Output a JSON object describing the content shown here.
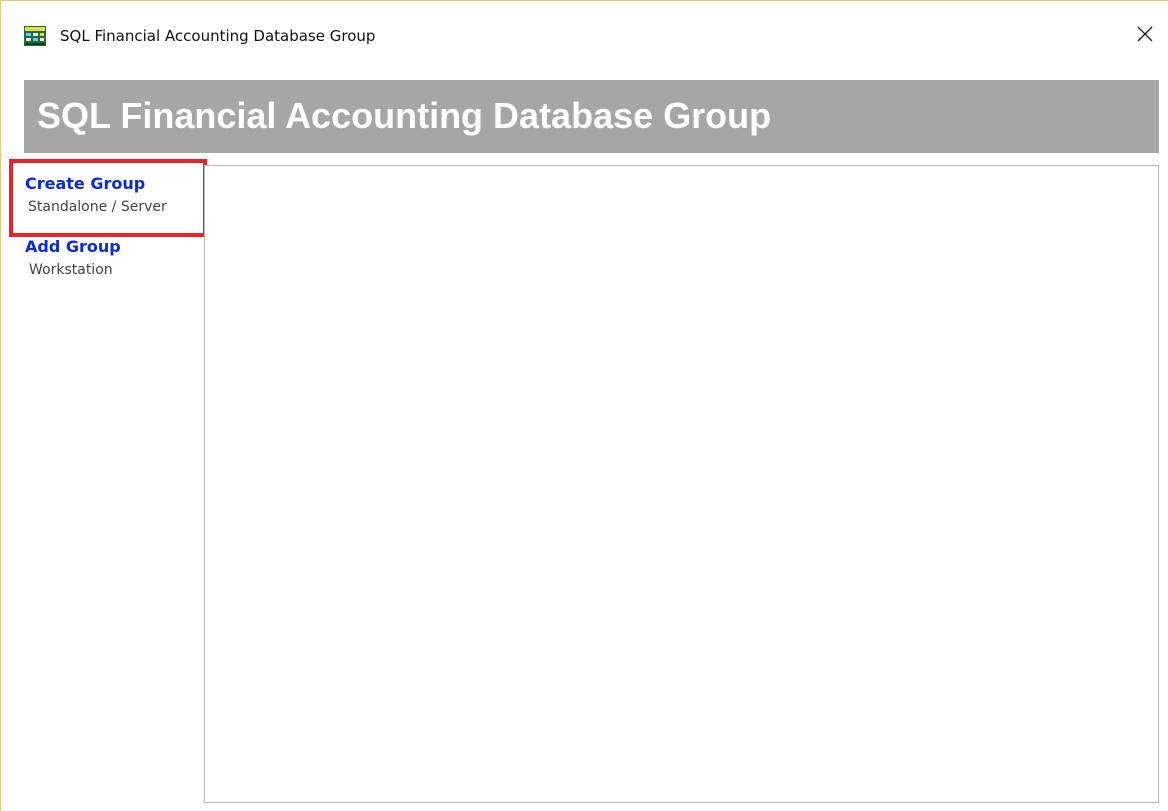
{
  "window": {
    "title": "SQL Financial Accounting Database Group",
    "close_glyph": "✕"
  },
  "banner": {
    "title": "SQL Financial Accounting Database Group",
    "background": "#a6a6a6",
    "text_color": "#ffffff"
  },
  "sidebar": {
    "items": [
      {
        "title": "Create Group",
        "subtitle": "Standalone / Server",
        "selected": true
      },
      {
        "title": "Add Group",
        "subtitle": "Workstation",
        "selected": false
      }
    ],
    "link_color": "#0a2bd8",
    "selection_color": "#e8232c"
  },
  "icons": {
    "app": "app-icon",
    "close": "close-icon"
  }
}
